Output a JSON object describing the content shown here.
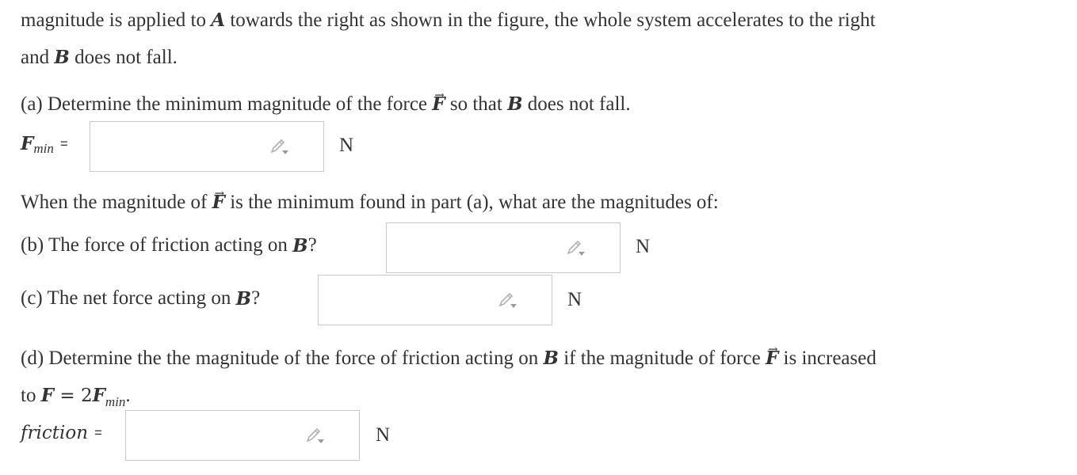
{
  "intro": {
    "line1": "magnitude is applied to",
    "varA": "A",
    "line1b": "towards the right as shown in the figure, the whole system accelerates to the right",
    "line2a": "and",
    "varB": "B",
    "line2b": "does not fall."
  },
  "part_a": {
    "prompt_a": "(a) Determine the minimum magnitude of the force",
    "vecF": "F",
    "prompt_b": "so that",
    "varB": "B",
    "prompt_c": "does not fall.",
    "label_main": "F",
    "label_sub": "min",
    "equals": "=",
    "unit": "N"
  },
  "intermediate": {
    "text_a": "When the magnitude of",
    "vecF": "F",
    "text_b": "is the minimum found in part (a), what are the magnitudes of:"
  },
  "part_b": {
    "prompt": "(b) The force of friction acting on",
    "varB": "B",
    "q": "?",
    "unit": "N"
  },
  "part_c": {
    "prompt": "(c) The net force acting on",
    "varB": "B",
    "q": "?",
    "unit": "N"
  },
  "part_d": {
    "line1a": "(d) Determine the the magnitude of the force of friction acting on",
    "varB": "B",
    "line1b": "if the magnitude of force",
    "vecF": "F",
    "line1c": "is increased",
    "line2a": "to",
    "eq_F": "F",
    "eq_mid": " = 2",
    "eq_F2": "F",
    "eq_sub": "min",
    "eq_end": ".",
    "label": "friction",
    "equals": "=",
    "unit": "N"
  },
  "icons": {
    "edit": "pencil-dropdown-icon"
  }
}
